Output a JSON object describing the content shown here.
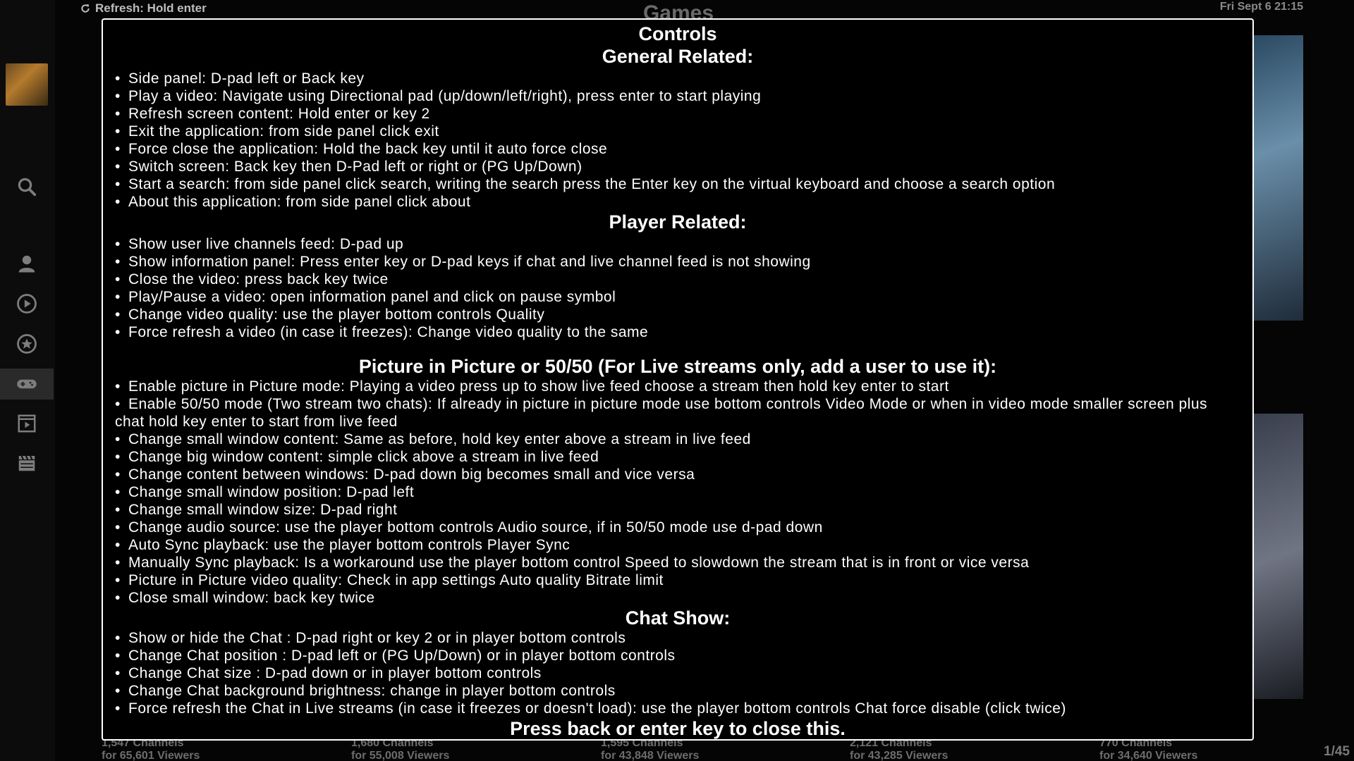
{
  "topbar": {
    "refresh_hint": "Refresh: Hold enter",
    "screen_title": "Games",
    "clock": "Fri Sept 6 21:15"
  },
  "sidepanel": {
    "icons": [
      "search-icon",
      "user-icon",
      "play-circle-icon",
      "star-icon",
      "gamepad-icon",
      "video-playlist-icon",
      "clapperboard-icon"
    ],
    "active": "gamepad-icon"
  },
  "background": {
    "captions": [
      {
        "channels": "1,547 Channels",
        "viewers": "for 65,601 Viewers"
      },
      {
        "channels": "1,680 Channels",
        "viewers": "for 55,008 Viewers"
      },
      {
        "channels": "1,595 Channels",
        "viewers": "for 43,848 Viewers"
      },
      {
        "channels": "2,121 Channels",
        "viewers": "for 43,285 Viewers"
      },
      {
        "channels": "770 Channels",
        "viewers": "for 34,640 Viewers"
      }
    ],
    "pager": "1/45"
  },
  "modal": {
    "title": "Controls",
    "general": {
      "heading": "General Related:",
      "items": [
        "Side panel: D-pad left or Back key",
        "Play a video: Navigate using Directional pad (up/down/left/right), press enter to start playing",
        "Refresh screen content: Hold enter or key 2",
        "Exit the application: from side panel click exit",
        "Force close the application: Hold the back key until it auto force close",
        "Switch screen: Back key then D-Pad left or right or (PG Up/Down)",
        "Start a search: from side panel click search, writing the search press the Enter key on the virtual keyboard and choose a search option",
        "About this application: from side panel click about"
      ]
    },
    "player": {
      "heading": "Player Related:",
      "items": [
        "Show user live channels feed: D-pad up",
        "Show information panel: Press enter key or D-pad keys if chat and live channel feed is not showing",
        "Close the video: press back key twice",
        "Play/Pause a video: open information panel and click on pause symbol",
        "Change video quality: use the player bottom controls Quality",
        "Force refresh a video (in case it freezes): Change video quality to the same"
      ]
    },
    "pip": {
      "heading": "Picture in Picture or 50/50 (For Live streams only, add a user to use it):",
      "items": [
        "Enable picture in Picture mode: Playing a video press up to show live feed choose a stream then hold key enter to start",
        "Enable 50/50 mode (Two stream two chats): If already in picture in picture mode use bottom controls Video Mode or when in video mode smaller screen plus chat hold key enter to start from live feed",
        "Change small window content: Same as before, hold key enter above a stream in live feed",
        "Change big window content: simple click above a stream in live feed",
        "Change content between windows: D-pad down big becomes small and vice versa",
        "Change small window position: D-pad left",
        "Change small window size: D-pad right",
        "Change audio source: use the player bottom controls Audio source, if in 50/50 mode use d-pad down",
        "Auto Sync playback: use the player bottom controls Player Sync",
        "Manually Sync playback: Is a workaround use the player bottom control Speed to slowdown the stream that is in front or vice versa",
        "Picture in Picture video quality: Check in app settings Auto quality Bitrate limit",
        "Close small window: back key twice"
      ]
    },
    "chat": {
      "heading": "Chat Show:",
      "items": [
        "Show or hide the Chat : D-pad right or key 2 or in player bottom controls",
        "Change Chat position : D-pad left or (PG Up/Down) or in player bottom controls",
        "Change Chat size : D-pad down or in player bottom controls",
        "Change Chat background brightness: change in player bottom controls",
        "Force refresh the Chat in Live streams (in case it freezes or doesn't load): use the player bottom controls Chat force disable (click twice)"
      ]
    },
    "footer": "Press back or enter key to close this."
  }
}
